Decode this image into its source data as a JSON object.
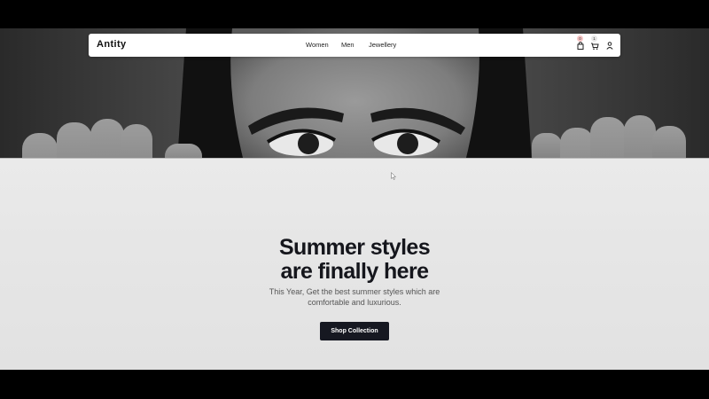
{
  "navbar": {
    "brand": "Antity",
    "links": [
      {
        "label": "Women"
      },
      {
        "label": "Men"
      },
      {
        "label": "Jewellery"
      }
    ],
    "icons": [
      {
        "name": "bag-icon",
        "badge": "0"
      },
      {
        "name": "cart-icon",
        "badge": "1"
      },
      {
        "name": "user-icon"
      }
    ]
  },
  "hero": {
    "headline_line1": "Summer styles",
    "headline_line2": "are finally here",
    "subtext_line1": "This Year, Get the best summer styles which are",
    "subtext_line2": "comfortable and luxurious.",
    "cta_label": "Shop Collection"
  },
  "colors": {
    "cta_background": "#161821",
    "headline": "#15161c",
    "badge_bag": "#f6c4c4",
    "badge_cart": "#e6e6e6"
  }
}
